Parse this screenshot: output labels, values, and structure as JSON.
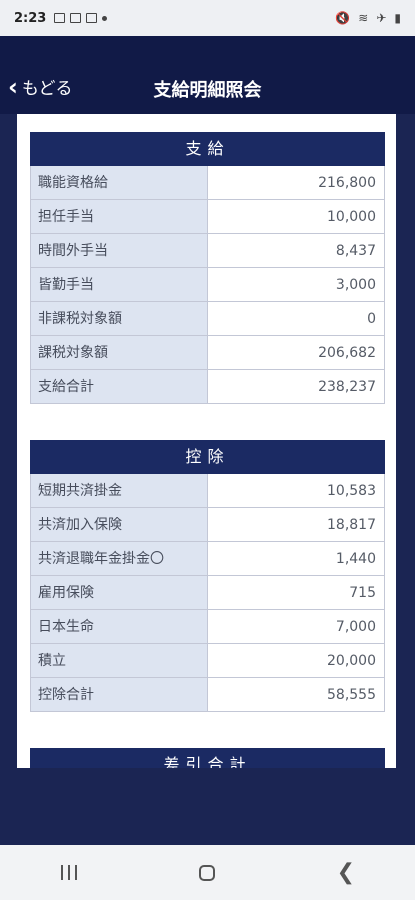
{
  "status_bar": {
    "time": "2:23"
  },
  "header": {
    "back_label": "もどる",
    "title": "支給明細照会"
  },
  "payments": {
    "title": "支給",
    "rows": [
      {
        "label": "職能資格給",
        "value": "216,800"
      },
      {
        "label": "担任手当",
        "value": "10,000"
      },
      {
        "label": "時間外手当",
        "value": "8,437"
      },
      {
        "label": "皆勤手当",
        "value": "3,000"
      },
      {
        "label": "非課税対象額",
        "value": "0"
      },
      {
        "label": "課税対象額",
        "value": "206,682"
      },
      {
        "label": "支給合計",
        "value": "238,237"
      }
    ]
  },
  "deductions": {
    "title": "控除",
    "rows": [
      {
        "label": "短期共済掛金",
        "value": "10,583"
      },
      {
        "label": "共済加入保険",
        "value": "18,817"
      },
      {
        "label": "共済退職年金掛金〇",
        "value": "1,440"
      },
      {
        "label": "雇用保険",
        "value": "715"
      },
      {
        "label": "日本生命",
        "value": "7,000"
      },
      {
        "label": "積立",
        "value": "20,000"
      },
      {
        "label": "控除合計",
        "value": "58,555"
      }
    ]
  },
  "net": {
    "title": "差引合計"
  },
  "colors": {
    "header_bg": "#111a47",
    "section_header": "#1b2a63",
    "label_bg": "#dde4f1"
  }
}
